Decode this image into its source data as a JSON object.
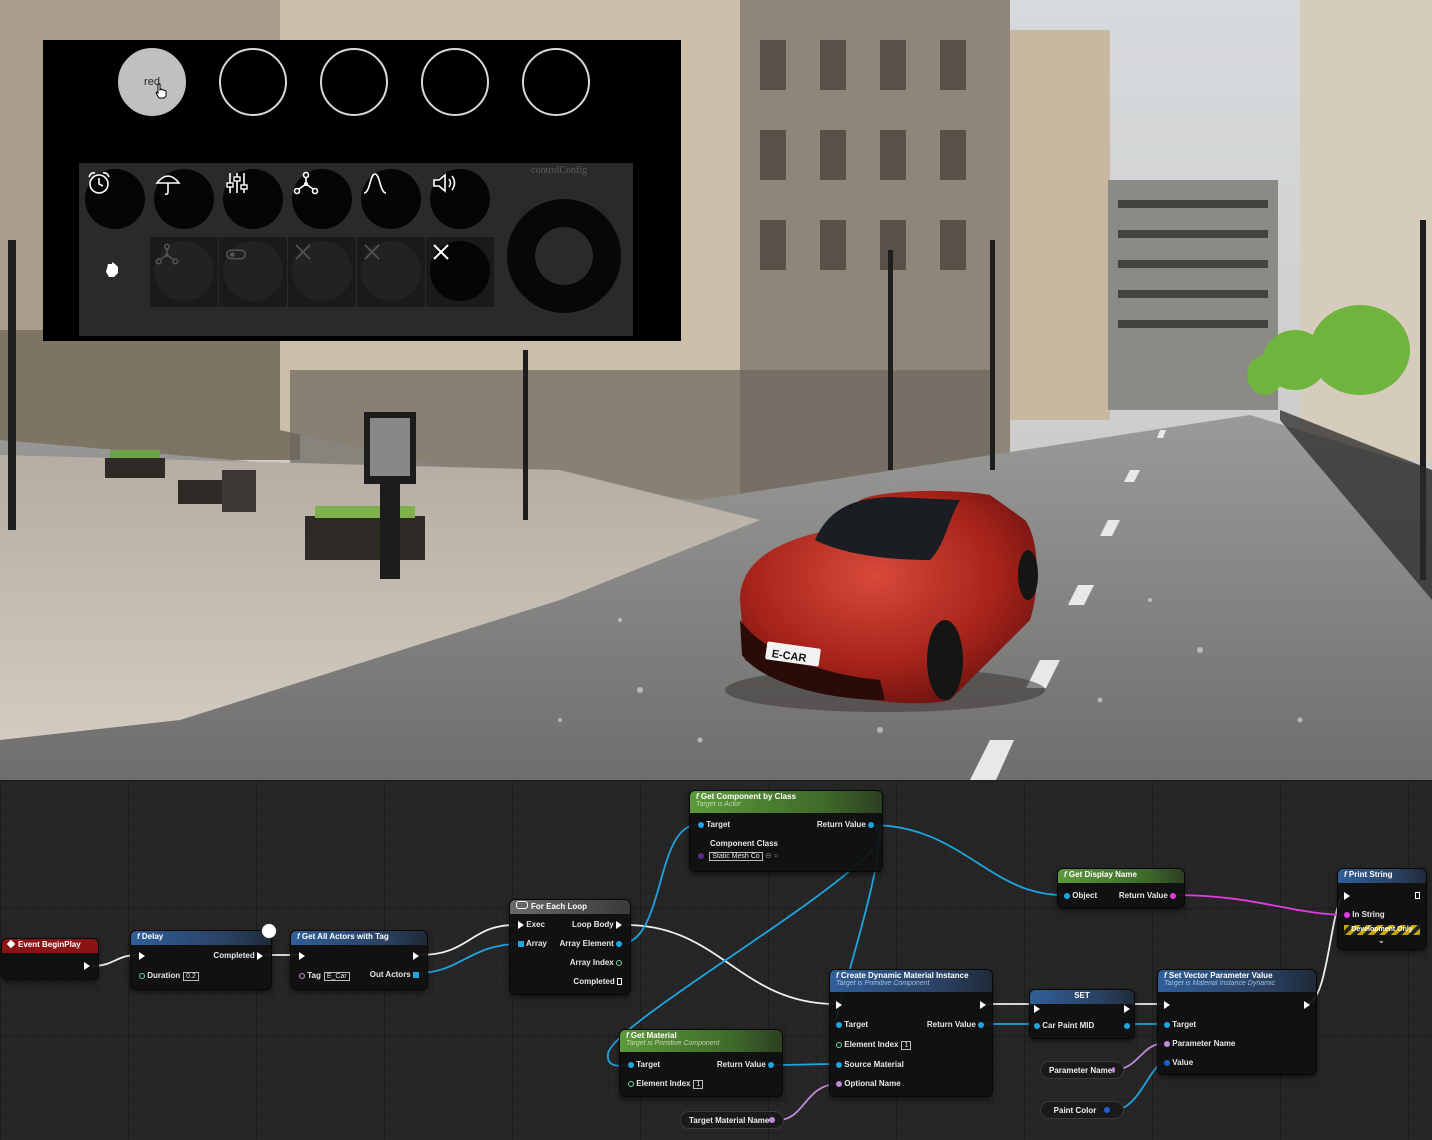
{
  "widget": {
    "swatches": [
      {
        "label": "red",
        "selected": true
      },
      {
        "label": "",
        "selected": false
      },
      {
        "label": "",
        "selected": false
      },
      {
        "label": "",
        "selected": false
      },
      {
        "label": "",
        "selected": false
      }
    ],
    "icon_row_1": [
      "alarm-clock-icon",
      "umbrella-icon",
      "sliders-icon",
      "network-icon",
      "bell-curve-icon",
      "speaker-icon"
    ],
    "icon_row_2": [
      "pointer-icon",
      "network-icon",
      "toggle-icon",
      "close-icon",
      "close-icon",
      "close-icon"
    ],
    "control_config_label": "controlConfig",
    "accent_color": "#c0c0c0"
  },
  "scene": {
    "license_plate": "E-CAR",
    "car_color": "#b3261e"
  },
  "blueprint": {
    "nodes": {
      "event_begin_play": {
        "title": "Event BeginPlay"
      },
      "delay": {
        "title": "Delay",
        "completed": "Completed",
        "duration_label": "Duration",
        "duration_value": "0.2"
      },
      "get_all_actors": {
        "title": "Get All Actors with Tag",
        "tag_label": "Tag",
        "tag_value": "E_Car",
        "out_actors": "Out Actors"
      },
      "for_each": {
        "title": "For Each Loop",
        "exec": "Exec",
        "array": "Array",
        "loop_body": "Loop Body",
        "array_element": "Array Element",
        "array_index": "Array Index",
        "completed": "Completed"
      },
      "get_component": {
        "title": "Get Component by Class",
        "subtitle": "Target is Actor",
        "target": "Target",
        "return_value": "Return Value",
        "component_class": "Component Class",
        "component_value": "Static Mesh Co"
      },
      "get_display_name": {
        "title": "Get Display Name",
        "object": "Object",
        "return_value": "Return Value"
      },
      "print_string": {
        "title": "Print String",
        "in_string": "In String",
        "dev_only": "Development Only"
      },
      "get_material": {
        "title": "Get Material",
        "subtitle": "Target is Primitive Component",
        "target": "Target",
        "return_value": "Return Value",
        "element_index": "Element Index",
        "element_index_value": "1"
      },
      "create_dmi": {
        "title": "Create Dynamic Material Instance",
        "subtitle": "Target is Primitive Component",
        "target": "Target",
        "return_value": "Return Value",
        "element_index": "Element Index",
        "element_index_value": "1",
        "source_material": "Source Material",
        "optional_name": "Optional Name"
      },
      "set_node": {
        "title": "SET",
        "var": "Car Paint MID"
      },
      "set_vector": {
        "title": "Set Vector Parameter Value",
        "subtitle": "Target is Material Instance Dynamic",
        "target": "Target",
        "parameter_name": "Parameter Name",
        "value": "Value"
      },
      "var_parameter_name": {
        "label": "Parameter Name"
      },
      "var_paint_color": {
        "label": "Paint Color"
      },
      "var_target_material_name": {
        "label": "Target Material Name"
      }
    },
    "colors": {
      "exec": "#ffffff",
      "object": "#1ea4e0",
      "string": "#e23ce2",
      "name": "#c08ad9",
      "int": "#6cd8a0"
    }
  }
}
